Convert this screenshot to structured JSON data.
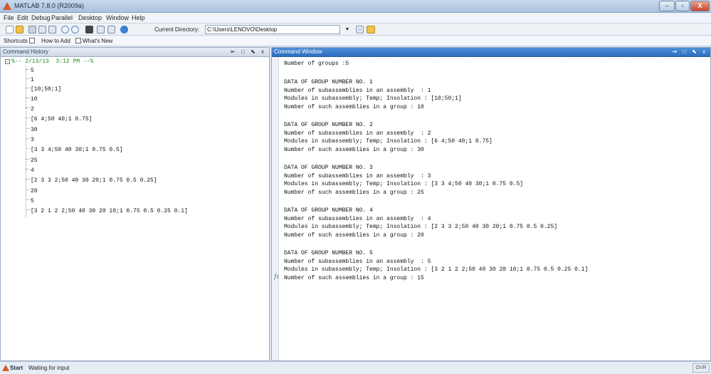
{
  "window": {
    "title": "MATLAB 7.8.0 (R2009a)",
    "min": "–",
    "max": "▫",
    "close": "X"
  },
  "menu": [
    "File",
    "Edit",
    "Debug",
    "Parallel",
    "Desktop",
    "Window",
    "Help"
  ],
  "toolbar": {
    "current_directory_label": "Current Directory:",
    "current_directory_value": "C:\\Users\\LENOVO\\Desktop",
    "dropdown": "▼",
    "browse": "..."
  },
  "shortcuts": {
    "shortcuts": "Shortcuts",
    "how_to_add": "How to Add",
    "whats_new": "What's New"
  },
  "history": {
    "title": "Command History",
    "controls": "⇤ □ ⬉ x",
    "header": "%-- 2/13/13  3:12 PM --%",
    "collapse": "−",
    "items": [
      "5",
      "1",
      "[10;50;1]",
      "10",
      "2",
      "[6 4;50 40;1 0.75]",
      "30",
      "3",
      "[3 3 4;50 40 30;1 0.75 0.5]",
      "25",
      "4",
      "[2 3 3 2;50 40 30 20;1 0.75 0.5 0.25]",
      "20",
      "5",
      "[3 2 1 2 2;50 40 30 20 10;1 0.75 0.5 0.25 0.1]"
    ]
  },
  "command_window": {
    "title": "Command Window",
    "controls": "⇥ □ ⬉ x",
    "prompt_icon": "fx",
    "lines": [
      "Number of groups :5",
      "",
      "DATA OF GROUP NUMBER NO. 1",
      "Number of subassemblies in an assembly  : 1",
      "Modules in subassembly; Temp; Insolation : [10;50;1]",
      "Number of such assemblies in a group : 10",
      "",
      "DATA OF GROUP NUMBER NO. 2",
      "Number of subassemblies in an assembly  : 2",
      "Modules in subassembly; Temp; Insolation : [6 4;50 40;1 0.75]",
      "Number of such assemblies in a group : 30",
      "",
      "DATA OF GROUP NUMBER NO. 3",
      "Number of subassemblies in an assembly  : 3",
      "Modules in subassembly; Temp; Insolation : [3 3 4;50 40 30;1 0.75 0.5]",
      "Number of such assemblies in a group : 25",
      "",
      "DATA OF GROUP NUMBER NO. 4",
      "Number of subassemblies in an assembly  : 4",
      "Modules in subassembly; Temp; Insolation : [2 3 3 2;50 40 30 20;1 0.75 0.5 0.25]",
      "Number of such assemblies in a group : 20",
      "",
      "DATA OF GROUP NUMBER NO. 5",
      "Number of subassemblies in an assembly  : 5",
      "Modules in subassembly; Temp; Insolation : [3 2 1 2 2;50 40 30 20 10;1 0.75 0.5 0.25 0.1]",
      "Number of such assemblies in a group : 15"
    ]
  },
  "status": {
    "start": "Start",
    "text": "Waiting for input",
    "ovr": "OVR"
  }
}
